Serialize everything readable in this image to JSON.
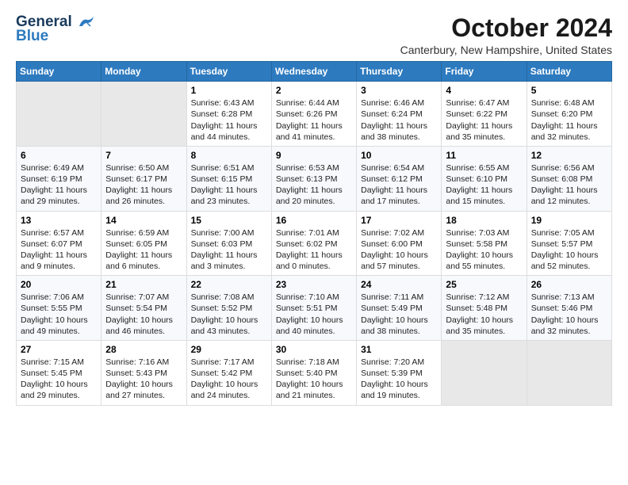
{
  "header": {
    "logo_line1": "General",
    "logo_line2": "Blue",
    "month": "October 2024",
    "location": "Canterbury, New Hampshire, United States"
  },
  "weekdays": [
    "Sunday",
    "Monday",
    "Tuesday",
    "Wednesday",
    "Thursday",
    "Friday",
    "Saturday"
  ],
  "rows": [
    [
      {
        "day": "",
        "empty": true
      },
      {
        "day": "",
        "empty": true
      },
      {
        "day": "1",
        "info": "Sunrise: 6:43 AM\nSunset: 6:28 PM\nDaylight: 11 hours\nand 44 minutes."
      },
      {
        "day": "2",
        "info": "Sunrise: 6:44 AM\nSunset: 6:26 PM\nDaylight: 11 hours\nand 41 minutes."
      },
      {
        "day": "3",
        "info": "Sunrise: 6:46 AM\nSunset: 6:24 PM\nDaylight: 11 hours\nand 38 minutes."
      },
      {
        "day": "4",
        "info": "Sunrise: 6:47 AM\nSunset: 6:22 PM\nDaylight: 11 hours\nand 35 minutes."
      },
      {
        "day": "5",
        "info": "Sunrise: 6:48 AM\nSunset: 6:20 PM\nDaylight: 11 hours\nand 32 minutes."
      }
    ],
    [
      {
        "day": "6",
        "info": "Sunrise: 6:49 AM\nSunset: 6:19 PM\nDaylight: 11 hours\nand 29 minutes."
      },
      {
        "day": "7",
        "info": "Sunrise: 6:50 AM\nSunset: 6:17 PM\nDaylight: 11 hours\nand 26 minutes."
      },
      {
        "day": "8",
        "info": "Sunrise: 6:51 AM\nSunset: 6:15 PM\nDaylight: 11 hours\nand 23 minutes."
      },
      {
        "day": "9",
        "info": "Sunrise: 6:53 AM\nSunset: 6:13 PM\nDaylight: 11 hours\nand 20 minutes."
      },
      {
        "day": "10",
        "info": "Sunrise: 6:54 AM\nSunset: 6:12 PM\nDaylight: 11 hours\nand 17 minutes."
      },
      {
        "day": "11",
        "info": "Sunrise: 6:55 AM\nSunset: 6:10 PM\nDaylight: 11 hours\nand 15 minutes."
      },
      {
        "day": "12",
        "info": "Sunrise: 6:56 AM\nSunset: 6:08 PM\nDaylight: 11 hours\nand 12 minutes."
      }
    ],
    [
      {
        "day": "13",
        "info": "Sunrise: 6:57 AM\nSunset: 6:07 PM\nDaylight: 11 hours\nand 9 minutes."
      },
      {
        "day": "14",
        "info": "Sunrise: 6:59 AM\nSunset: 6:05 PM\nDaylight: 11 hours\nand 6 minutes."
      },
      {
        "day": "15",
        "info": "Sunrise: 7:00 AM\nSunset: 6:03 PM\nDaylight: 11 hours\nand 3 minutes."
      },
      {
        "day": "16",
        "info": "Sunrise: 7:01 AM\nSunset: 6:02 PM\nDaylight: 11 hours\nand 0 minutes."
      },
      {
        "day": "17",
        "info": "Sunrise: 7:02 AM\nSunset: 6:00 PM\nDaylight: 10 hours\nand 57 minutes."
      },
      {
        "day": "18",
        "info": "Sunrise: 7:03 AM\nSunset: 5:58 PM\nDaylight: 10 hours\nand 55 minutes."
      },
      {
        "day": "19",
        "info": "Sunrise: 7:05 AM\nSunset: 5:57 PM\nDaylight: 10 hours\nand 52 minutes."
      }
    ],
    [
      {
        "day": "20",
        "info": "Sunrise: 7:06 AM\nSunset: 5:55 PM\nDaylight: 10 hours\nand 49 minutes."
      },
      {
        "day": "21",
        "info": "Sunrise: 7:07 AM\nSunset: 5:54 PM\nDaylight: 10 hours\nand 46 minutes."
      },
      {
        "day": "22",
        "info": "Sunrise: 7:08 AM\nSunset: 5:52 PM\nDaylight: 10 hours\nand 43 minutes."
      },
      {
        "day": "23",
        "info": "Sunrise: 7:10 AM\nSunset: 5:51 PM\nDaylight: 10 hours\nand 40 minutes."
      },
      {
        "day": "24",
        "info": "Sunrise: 7:11 AM\nSunset: 5:49 PM\nDaylight: 10 hours\nand 38 minutes."
      },
      {
        "day": "25",
        "info": "Sunrise: 7:12 AM\nSunset: 5:48 PM\nDaylight: 10 hours\nand 35 minutes."
      },
      {
        "day": "26",
        "info": "Sunrise: 7:13 AM\nSunset: 5:46 PM\nDaylight: 10 hours\nand 32 minutes."
      }
    ],
    [
      {
        "day": "27",
        "info": "Sunrise: 7:15 AM\nSunset: 5:45 PM\nDaylight: 10 hours\nand 29 minutes."
      },
      {
        "day": "28",
        "info": "Sunrise: 7:16 AM\nSunset: 5:43 PM\nDaylight: 10 hours\nand 27 minutes."
      },
      {
        "day": "29",
        "info": "Sunrise: 7:17 AM\nSunset: 5:42 PM\nDaylight: 10 hours\nand 24 minutes."
      },
      {
        "day": "30",
        "info": "Sunrise: 7:18 AM\nSunset: 5:40 PM\nDaylight: 10 hours\nand 21 minutes."
      },
      {
        "day": "31",
        "info": "Sunrise: 7:20 AM\nSunset: 5:39 PM\nDaylight: 10 hours\nand 19 minutes."
      },
      {
        "day": "",
        "empty": true
      },
      {
        "day": "",
        "empty": true
      }
    ]
  ]
}
